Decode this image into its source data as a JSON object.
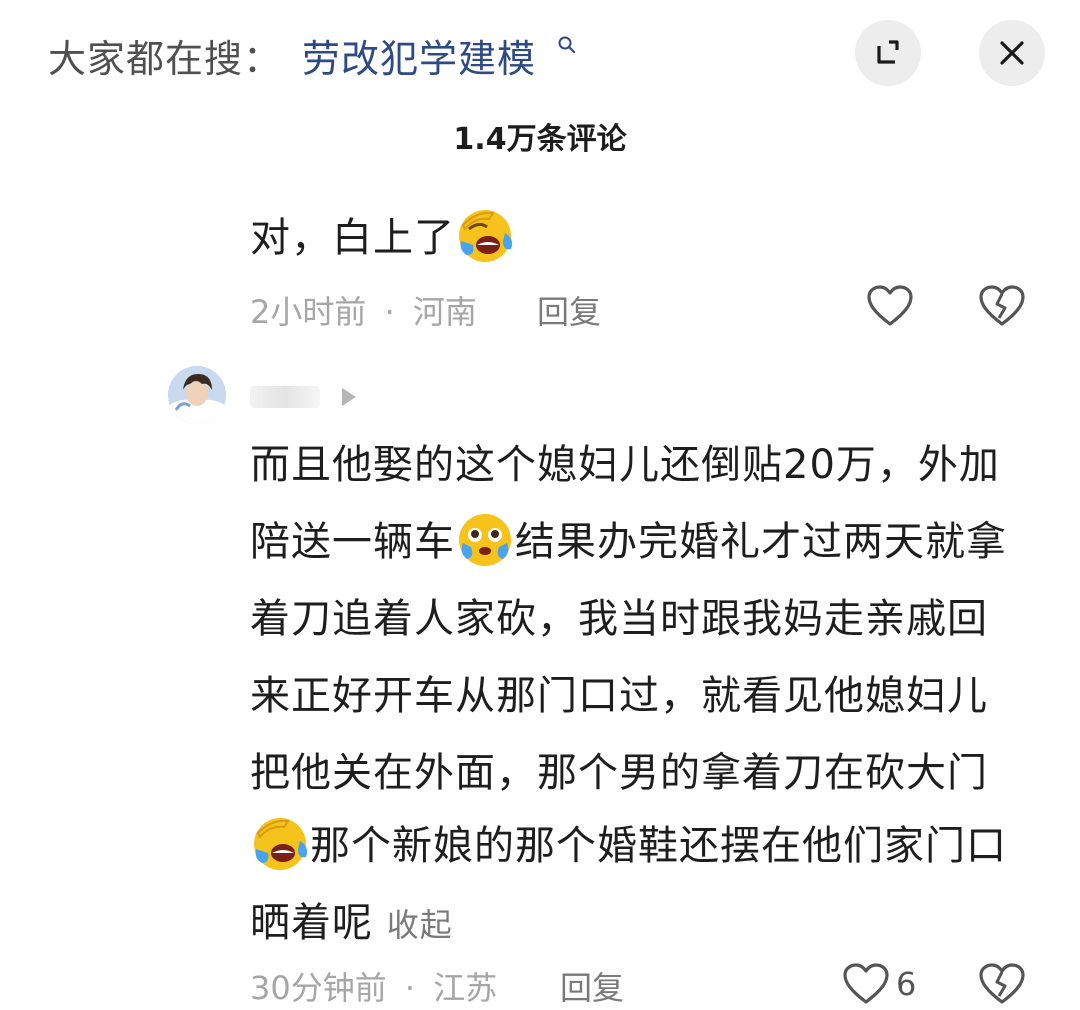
{
  "header": {
    "search_label": "大家都在搜：",
    "search_term": "劳改犯学建模",
    "comment_count": "1.4万条评论"
  },
  "comments": [
    {
      "text": "对，白上了",
      "time": "2小时前",
      "separator": "·",
      "location": "河南",
      "reply_label": "回复"
    },
    {
      "lines": [
        "而且他娶的这个媳妇儿还倒贴20万，外加",
        "陪送一辆车",
        "结果办完婚礼才过两天就拿",
        "着刀追着人家砍，我当时跟我妈走亲戚回",
        "来正好开车从那门口过，就看见他媳妇儿",
        "把他关在外面，那个男的拿着刀在砍大门",
        "那个新娘的那个婚鞋还摆在他们家门口",
        "晒着呢"
      ],
      "collapse_label": "收起",
      "time": "30分钟前",
      "separator": "·",
      "location": "江苏",
      "reply_label": "回复",
      "like_count": "6"
    }
  ],
  "icons": {
    "search": "search-icon",
    "collapse": "collapse-icon",
    "close": "close-icon",
    "like": "heart-icon",
    "dislike": "broken-heart-icon",
    "play": "play-icon",
    "emoji_crying": "crying-laughing-emoji",
    "emoji_pleading": "pleading-emoji"
  },
  "colors": {
    "search_term": "#2e4a86",
    "meta_gray": "#a6a6a6",
    "button_bg": "#ededed"
  }
}
